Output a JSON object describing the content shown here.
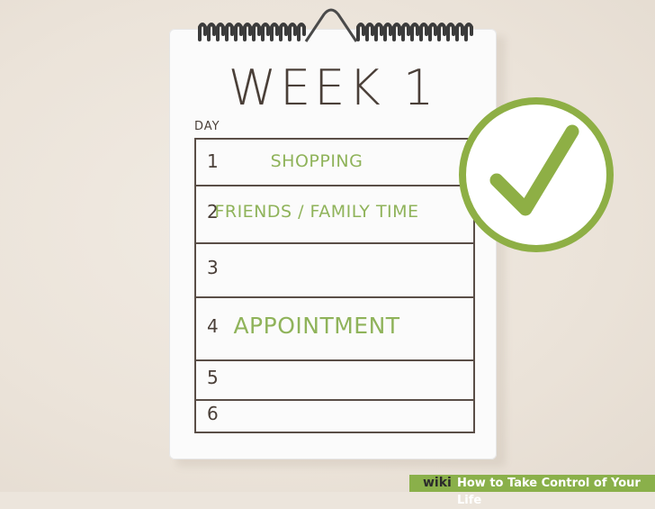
{
  "calendar": {
    "title": "WEEK 1",
    "column_label": "DAY",
    "days": [
      {
        "number": "1",
        "task": "SHOPPING"
      },
      {
        "number": "2",
        "task": "FRIENDS / FAMILY TIME"
      },
      {
        "number": "3",
        "task": ""
      },
      {
        "number": "4",
        "task": "APPOINTMENT"
      },
      {
        "number": "5",
        "task": ""
      },
      {
        "number": "6",
        "task": ""
      }
    ]
  },
  "watermark": {
    "site": "wiki",
    "title": "How to Take Control of Your Life"
  },
  "colors": {
    "accent_green": "#8eaf45",
    "ink": "#4a3f38",
    "wall": "#ece5dc"
  },
  "icons": {
    "checkmark": "checkmark-icon",
    "binding": "spiral-binding-icon"
  }
}
